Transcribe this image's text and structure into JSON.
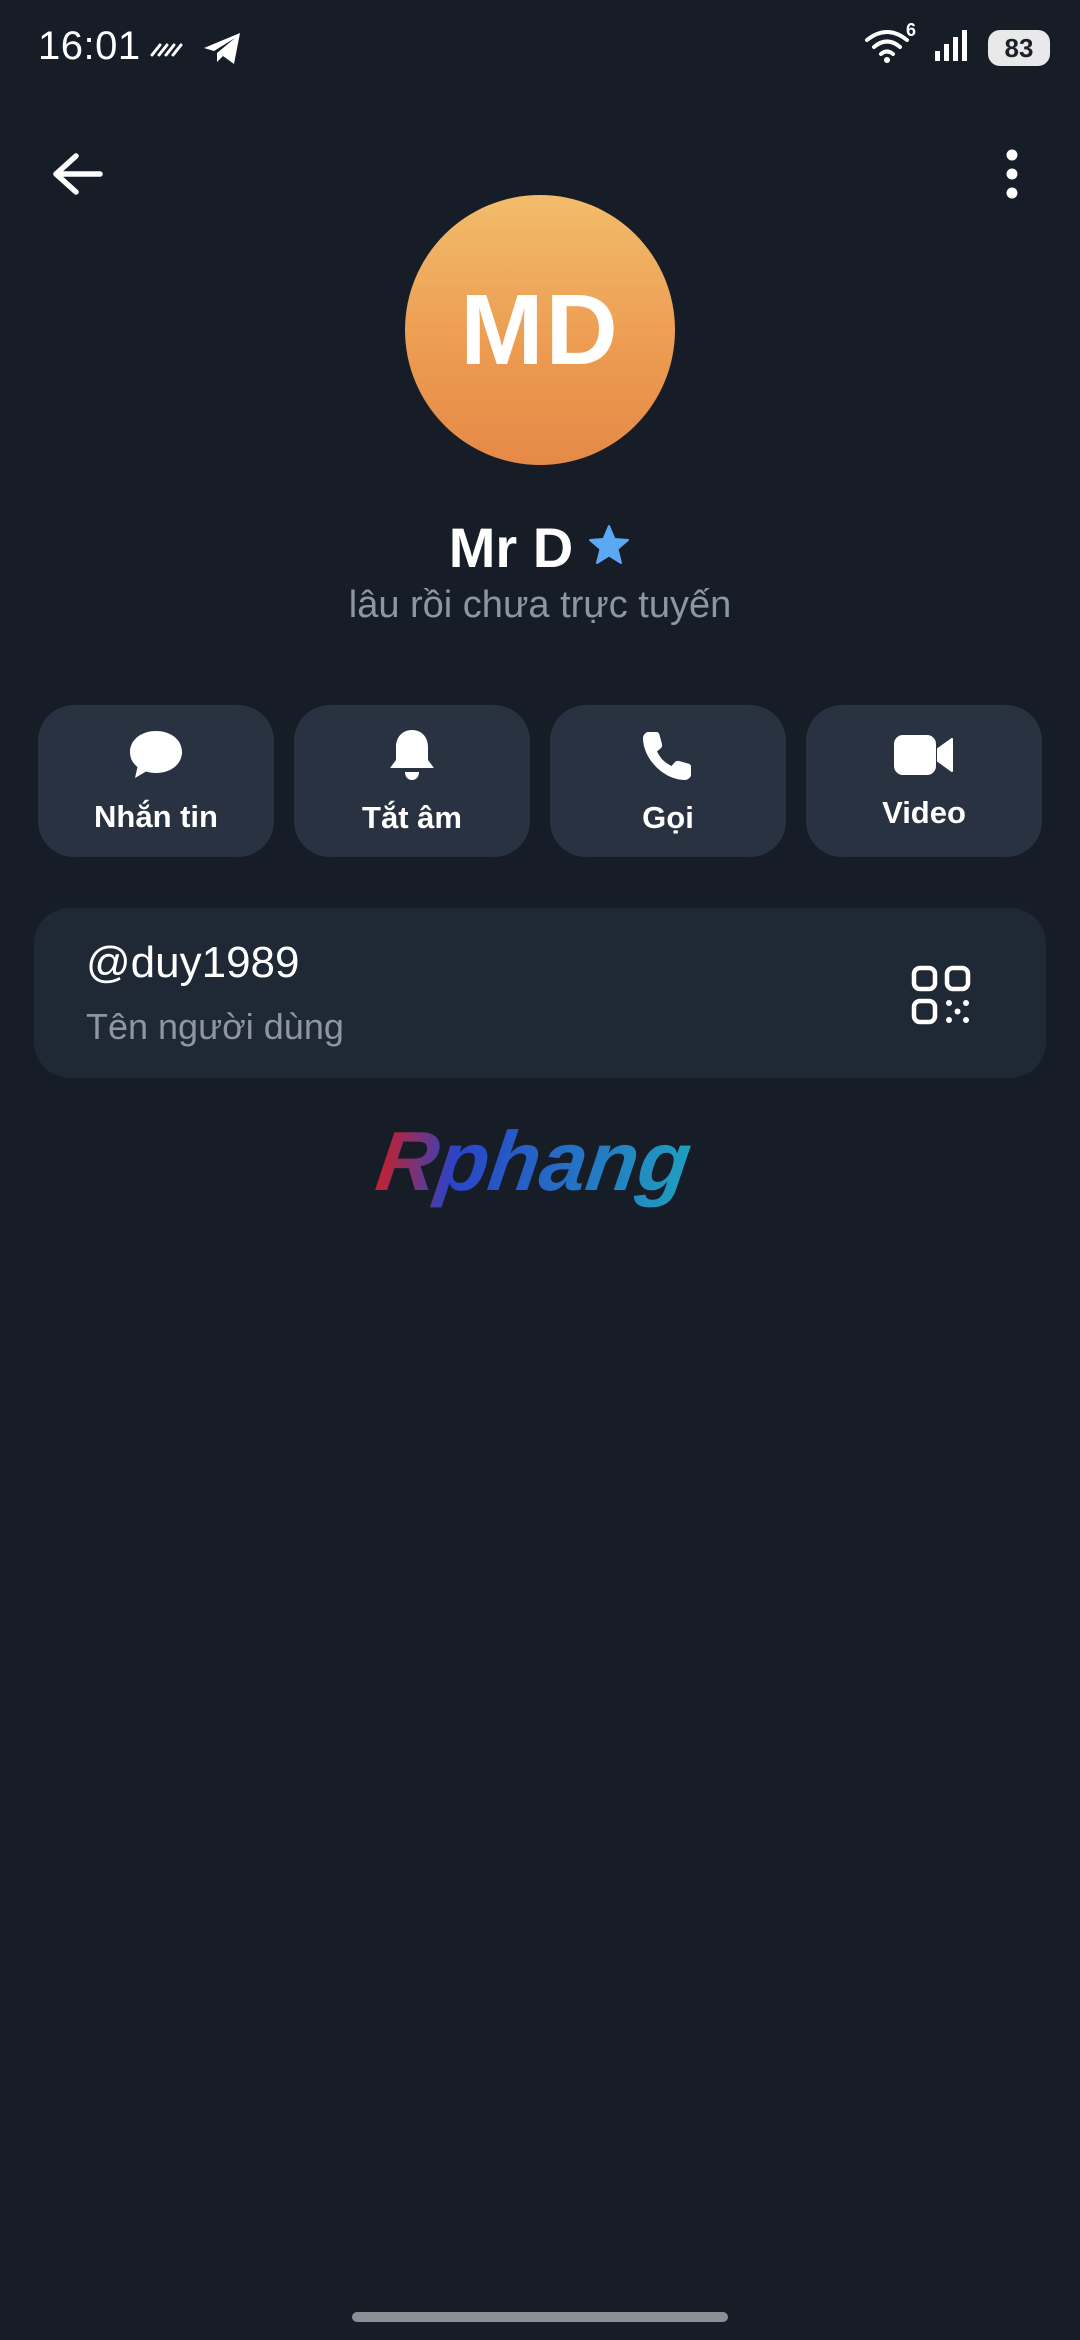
{
  "status_bar": {
    "time": "16:01",
    "network_label": "6",
    "battery": "83",
    "icons": [
      "hatched-notification-icon",
      "telegram-icon",
      "wifi-icon",
      "signal-icon",
      "battery-icon"
    ]
  },
  "header": {
    "back_icon": "arrow-left-icon",
    "more_icon": "more-vertical-icon"
  },
  "profile": {
    "initials": "MD",
    "name": "Mr D",
    "badge_icon": "star-badge-icon",
    "status": "lâu rồi chưa trực tuyến",
    "avatar_colors": [
      "#f2bc6b",
      "#e58947"
    ]
  },
  "actions": [
    {
      "label": "Nhắn tin",
      "icon": "chat-bubble-icon"
    },
    {
      "label": "Tắt âm",
      "icon": "bell-icon"
    },
    {
      "label": "Gọi",
      "icon": "phone-icon"
    },
    {
      "label": "Video",
      "icon": "video-camera-icon"
    }
  ],
  "user_card": {
    "username": "@duy1989",
    "label": "Tên người dùng",
    "qr_icon": "qr-code-icon"
  },
  "watermark": {
    "text": "Rphang"
  },
  "colors": {
    "background": "#171d27",
    "button": "#283241",
    "card": "#1f2835",
    "secondary_text": "#8e96a3",
    "badge": "#5ba8f5"
  }
}
